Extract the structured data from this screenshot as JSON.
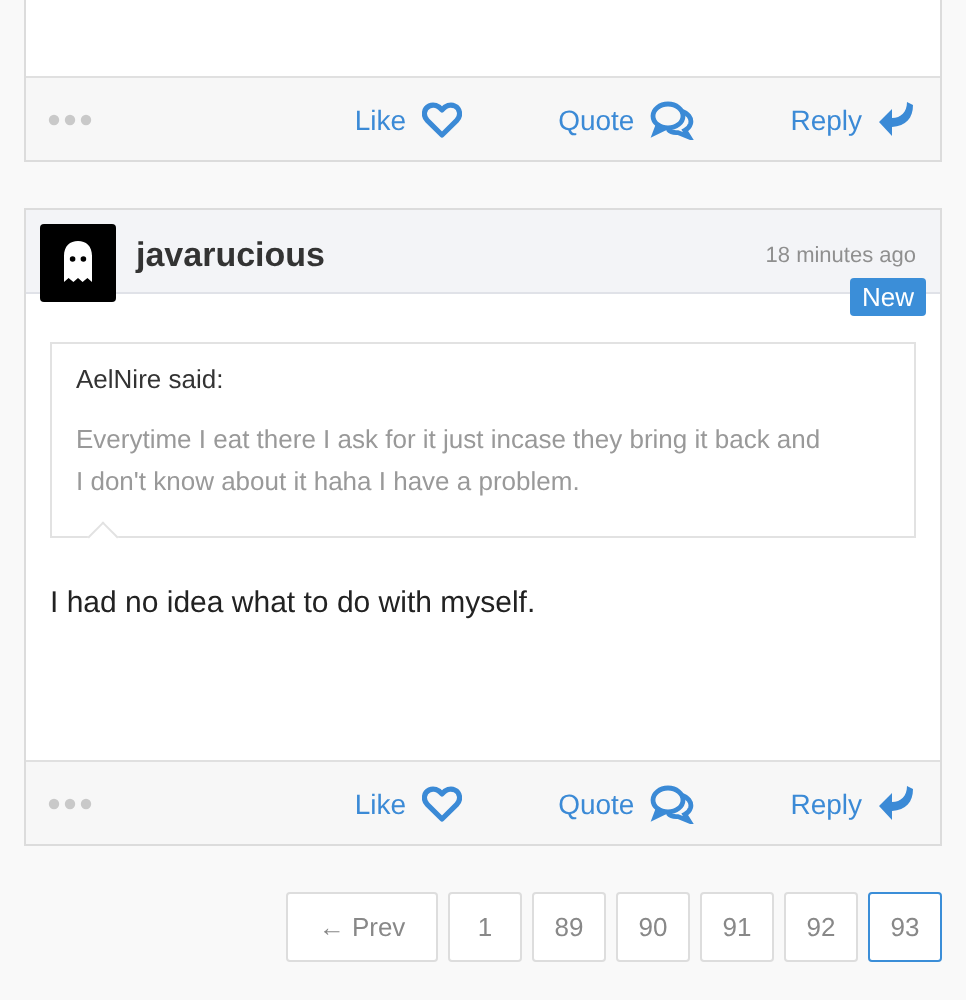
{
  "posts": [
    {
      "footer": {
        "actions": [
          {
            "label": "Like",
            "kind": "like"
          },
          {
            "label": "Quote",
            "kind": "quote"
          },
          {
            "label": "Reply",
            "kind": "reply"
          }
        ]
      }
    },
    {
      "author": "javarucious",
      "time": "18 minutes ago",
      "badge": "New",
      "quote": {
        "author": "AelNire said:",
        "text": "Everytime I eat there I ask for it just incase they bring it back and I don't know about it haha I have a problem."
      },
      "message": "I had no idea what to do with myself.",
      "footer": {
        "actions": [
          {
            "label": "Like",
            "kind": "like"
          },
          {
            "label": "Quote",
            "kind": "quote"
          },
          {
            "label": "Reply",
            "kind": "reply"
          }
        ]
      }
    }
  ],
  "pagination": {
    "prev": "← Prev",
    "pages": [
      {
        "label": "1",
        "selected": false
      },
      {
        "label": "89",
        "selected": false
      },
      {
        "label": "90",
        "selected": false
      },
      {
        "label": "91",
        "selected": false
      },
      {
        "label": "92",
        "selected": false
      },
      {
        "label": "93",
        "selected": true
      }
    ]
  }
}
